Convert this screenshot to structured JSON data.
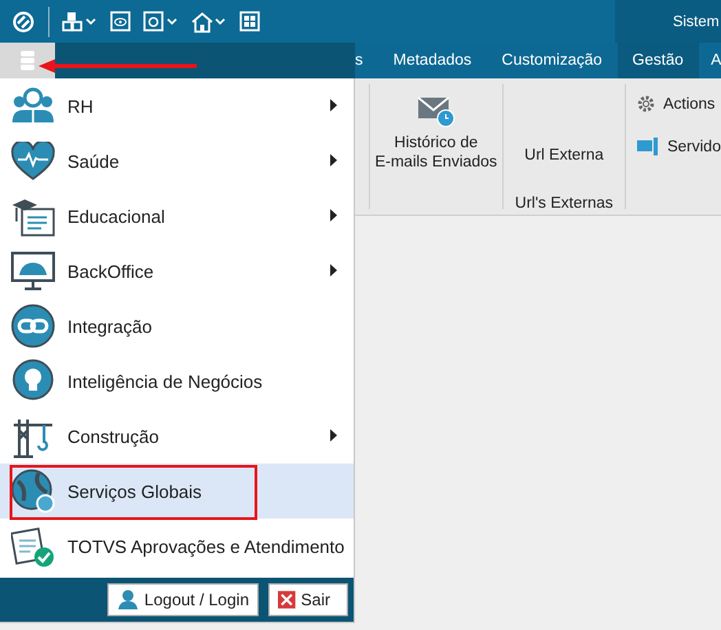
{
  "window": {
    "title": "Sistem"
  },
  "tabs": [
    {
      "label": "s",
      "selected": false
    },
    {
      "label": "Metadados",
      "selected": false
    },
    {
      "label": "Customização",
      "selected": false
    },
    {
      "label": "Gestão",
      "selected": true
    },
    {
      "label": "A",
      "selected": false
    }
  ],
  "ribbon": {
    "items": [
      {
        "kind": "large",
        "label": "Histórico de\nE-mails Enviados"
      },
      {
        "kind": "group",
        "label": "Url Externa",
        "group_label": "Url's Externas"
      },
      {
        "kind": "small",
        "label": "Actions"
      },
      {
        "kind": "small",
        "label": "Servido"
      }
    ]
  },
  "menu": {
    "items": [
      {
        "label": "RH",
        "submenu": true,
        "selected": false
      },
      {
        "label": "Saúde",
        "submenu": true,
        "selected": false
      },
      {
        "label": "Educacional",
        "submenu": true,
        "selected": false
      },
      {
        "label": "BackOffice",
        "submenu": true,
        "selected": false
      },
      {
        "label": "Integração",
        "submenu": false,
        "selected": false
      },
      {
        "label": "Inteligência de Negócios",
        "submenu": false,
        "selected": false
      },
      {
        "label": "Construção",
        "submenu": true,
        "selected": false
      },
      {
        "label": "Serviços Globais",
        "submenu": false,
        "selected": true
      },
      {
        "label": "TOTVS Aprovações e Atendimento",
        "submenu": false,
        "selected": false
      }
    ],
    "buttons": [
      {
        "kind": "logout",
        "label": "Logout / Login"
      },
      {
        "kind": "exit",
        "label": "Sair"
      }
    ]
  }
}
